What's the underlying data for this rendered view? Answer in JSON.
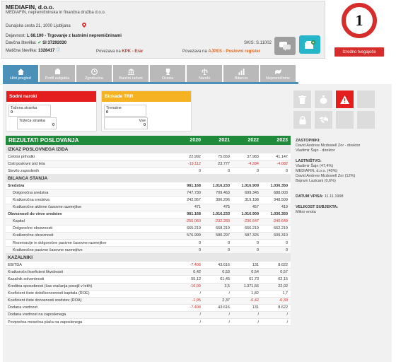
{
  "company": {
    "name": "MEDIAFIN, d.o.o.",
    "full_name": "MEDIAFIN, nepremičninska in finančna družba d.o.o.",
    "address": "Dunajska cesta 21, 1000 Ljubljana",
    "activity_label": "Dejavnost:",
    "activity": "L 68.100 - Trgovanje z lastnimi nepremičninami",
    "tax_label": "Davčna številka:",
    "tax": "SI 37292030",
    "reg_label": "Matična številka:",
    "reg": "1328417",
    "skis": "SKIS: S.11002",
    "kpk_prefix": "Povezava na",
    "kpk_link": "KPK - Erar",
    "ajpes_prefix": "Povezava na",
    "ajpes_link": "AJPES - Poslovni register"
  },
  "score": {
    "value": "1",
    "button": "Izredno tvegajoče"
  },
  "tabs": [
    {
      "label": "Hitri pregled"
    },
    {
      "label": "Profil subjekta"
    },
    {
      "label": "Zgodovina"
    },
    {
      "label": "Bančni računi"
    },
    {
      "label": "Ocena"
    },
    {
      "label": "Naroki"
    },
    {
      "label": "Bilanca"
    },
    {
      "label": "Nepremičnine"
    }
  ],
  "court_box": {
    "title": "Sodni naroki",
    "plaintiff_label": "Tožena stranka",
    "plaintiff_value": "0",
    "defendant_label": "Tožeča stranka",
    "defendant_value": "0"
  },
  "trr_box": {
    "title": "Blokade TRR",
    "current_label": "Trenutne",
    "current_value": "0",
    "all_label": "Vse",
    "all_value": "0"
  },
  "table": {
    "title": "REZULTATI POSLOVANJA",
    "years": [
      "2020",
      "2021",
      "2022",
      "2023"
    ],
    "rows": [
      {
        "type": "sec",
        "label": "IZKAZ POSLOVNEGA IZIDA"
      },
      {
        "label": "Celotni prihodki",
        "v": [
          "22.992",
          "75.659",
          "37.983",
          "41.147"
        ]
      },
      {
        "label": "Čisti poslovni izid leta",
        "v": [
          "-19.112",
          "23.777",
          "-4.284",
          "-4.082"
        ]
      },
      {
        "label": "Število zaposlenih",
        "v": [
          "0",
          "0",
          "0",
          "0"
        ]
      },
      {
        "type": "sec",
        "label": "BILANCA STANJA"
      },
      {
        "label": "Sredstva",
        "bold": true,
        "v": [
          "981.168",
          "1.016.233",
          "1.016.909",
          "1.036.350"
        ]
      },
      {
        "label": "Dolgoročna sredstva",
        "sub": true,
        "v": [
          "747.730",
          "709.463",
          "699.345",
          "688.003"
        ]
      },
      {
        "label": "Kratkoročna sredstva",
        "sub": true,
        "v": [
          "242.957",
          "306.296",
          "319.198",
          "348.509"
        ]
      },
      {
        "label": "Kratkoročne aktivne časovne razmejitve",
        "sub": true,
        "v": [
          "471",
          "475",
          "457",
          "419"
        ]
      },
      {
        "label": "Obveznosti do virov sredstev",
        "bold": true,
        "v": [
          "981.168",
          "1.016.233",
          "1.016.909",
          "1.036.350"
        ]
      },
      {
        "label": "Kapital",
        "sub": true,
        "v": [
          "-256.060",
          "-232.283",
          "-236.647",
          "-240.649"
        ]
      },
      {
        "label": "Dolgoročne obveznosti",
        "sub": true,
        "v": [
          "665.219",
          "668.219",
          "666.219",
          "662.219"
        ]
      },
      {
        "label": "Kratkoročne obveznosti",
        "sub": true,
        "v": [
          "576.999",
          "580.297",
          "587.326",
          "609.310"
        ]
      },
      {
        "label": "Rezervacije in dolgoročne pasivne časovne razmejitve",
        "sub": true,
        "v": [
          "0",
          "0",
          "0",
          "0"
        ]
      },
      {
        "label": "Kratkoročne pasivne časovne razmejitve",
        "sub": true,
        "v": [
          "0",
          "0",
          "0",
          "0"
        ]
      },
      {
        "type": "sec",
        "label": "KAZALNIKI"
      },
      {
        "label": "EBITDA",
        "v": [
          "-7.408",
          "43.616",
          "131",
          "8.622"
        ]
      },
      {
        "label": "Kratkoročni koeficient likvidnosti",
        "v": [
          "0,42",
          "0,53",
          "0,54",
          "0,57"
        ]
      },
      {
        "label": "Kazalnik solventnosti",
        "v": [
          "55,12",
          "61,45",
          "61,73",
          "62,15"
        ]
      },
      {
        "label": "Kreditna sposobnost (čas vračanja posojil v letih)",
        "v": [
          "-16,09",
          "3,5",
          "1.371,56",
          "22,02"
        ]
      },
      {
        "label": "Koeficient čiste dobičkonosnosti kapitala (ROE)",
        "v": [
          "/",
          "/",
          "1,82",
          "1,7"
        ]
      },
      {
        "label": "Koeficient čiste donosnosti sredstev (ROA)",
        "v": [
          "-1,95",
          "2,37",
          "-0,42",
          "-0,39"
        ]
      },
      {
        "label": "Dodana vrednost",
        "v": [
          "-7.408",
          "43.616",
          "131",
          "8.622"
        ]
      },
      {
        "label": "Dodana vrednost na zaposlenega",
        "v": [
          "/",
          "/",
          "/",
          "/"
        ]
      },
      {
        "label": "Povprečna mesečna plača na zaposlenega",
        "v": [
          "/",
          "/",
          "/",
          "/"
        ]
      }
    ]
  },
  "side": {
    "reps_label": "ZASTOPNIKI:",
    "reps_1": "David Andrew Mcdowell Zor - direktor",
    "reps_2": "Vladimir Šajn - direktor",
    "owners_label": "LASTNIŠTVO:",
    "owners_1": "Vladimir Šajn (47,4%)",
    "owners_2": "MEDIAFIN, d.o.o. (40%)",
    "owners_3": "David Andrew Mcdowell Zor (12%)",
    "owners_4": "Bajram Lazicani (0,6%)",
    "date_label": "DATUM VPISA:",
    "date": "11.11.1998",
    "size_label": "VELIKOST SUBJEKTA:",
    "size": "Mikro enota"
  },
  "colors": {
    "accent": "#4a90b8",
    "danger": "#e41e1e",
    "header_green": "#1f8b3a",
    "warning": "#f5b324"
  },
  "icons": [
    "map-pin-icon",
    "info-icon",
    "chat-icon",
    "add-to-list-icon",
    "trash-icon",
    "money-bag-icon",
    "warning-icon",
    "lock-icon",
    "handshake-icon"
  ]
}
